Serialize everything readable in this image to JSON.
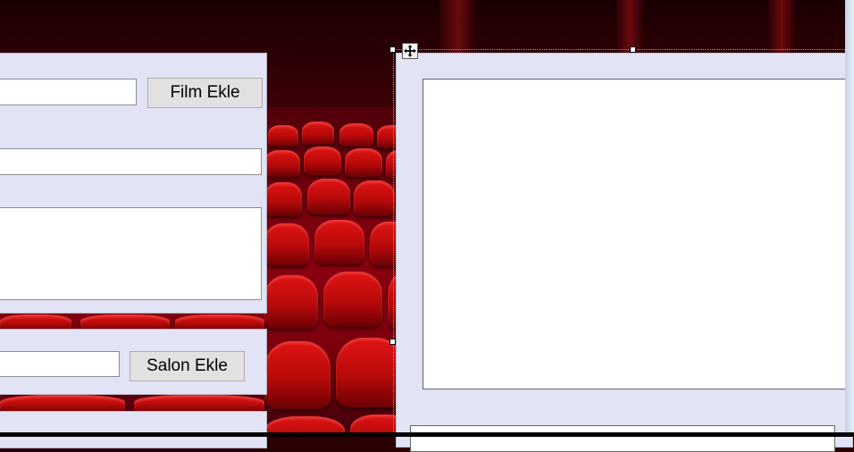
{
  "film_panel": {
    "add_film_button": "Film Ekle",
    "film_name_value": "",
    "second_field_value": "",
    "description_value": ""
  },
  "salon_panel": {
    "add_salon_button": "Salon Ekle",
    "salon_name_value": ""
  },
  "right_panel": {
    "list_items": []
  },
  "icons": {
    "move_handle": "move-arrows-icon"
  },
  "colors": {
    "panel_bg": "#e3e3f6",
    "button_bg": "#e1e1e1",
    "seat_red": "#d01010"
  }
}
